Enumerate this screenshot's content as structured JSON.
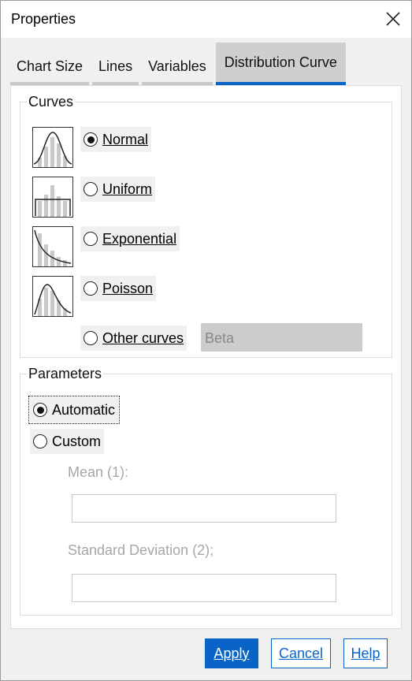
{
  "window": {
    "title": "Properties"
  },
  "tabs": [
    {
      "label": "Chart Size",
      "active": false
    },
    {
      "label": "Lines",
      "active": false
    },
    {
      "label": "Variables",
      "active": false
    },
    {
      "label": "Distribution Curve",
      "active": true
    }
  ],
  "curves": {
    "group_label": "Curves",
    "options": [
      {
        "label": "Normal",
        "selected": true,
        "icon": "normal-curve-icon"
      },
      {
        "label": "Uniform",
        "selected": false,
        "icon": "uniform-curve-icon"
      },
      {
        "label": "Exponential",
        "selected": false,
        "icon": "exponential-curve-icon"
      },
      {
        "label": "Poisson",
        "selected": false,
        "icon": "poisson-curve-icon"
      },
      {
        "label": "Other curves",
        "selected": false,
        "icon": ""
      }
    ],
    "other_curve_value": "Beta"
  },
  "parameters": {
    "group_label": "Parameters",
    "automatic_label": "Automatic",
    "custom_label": "Custom",
    "automatic_selected": true,
    "mean_label": "Mean (1):",
    "mean_value": "",
    "std_label": "Standard Deviation (2);",
    "std_value": ""
  },
  "buttons": {
    "apply": "Apply",
    "cancel": "Cancel",
    "help": "Help"
  },
  "colors": {
    "accent": "#0a64c8",
    "tab_active_bg": "#cfcfcf",
    "disabled_text": "#a6a6a6"
  }
}
